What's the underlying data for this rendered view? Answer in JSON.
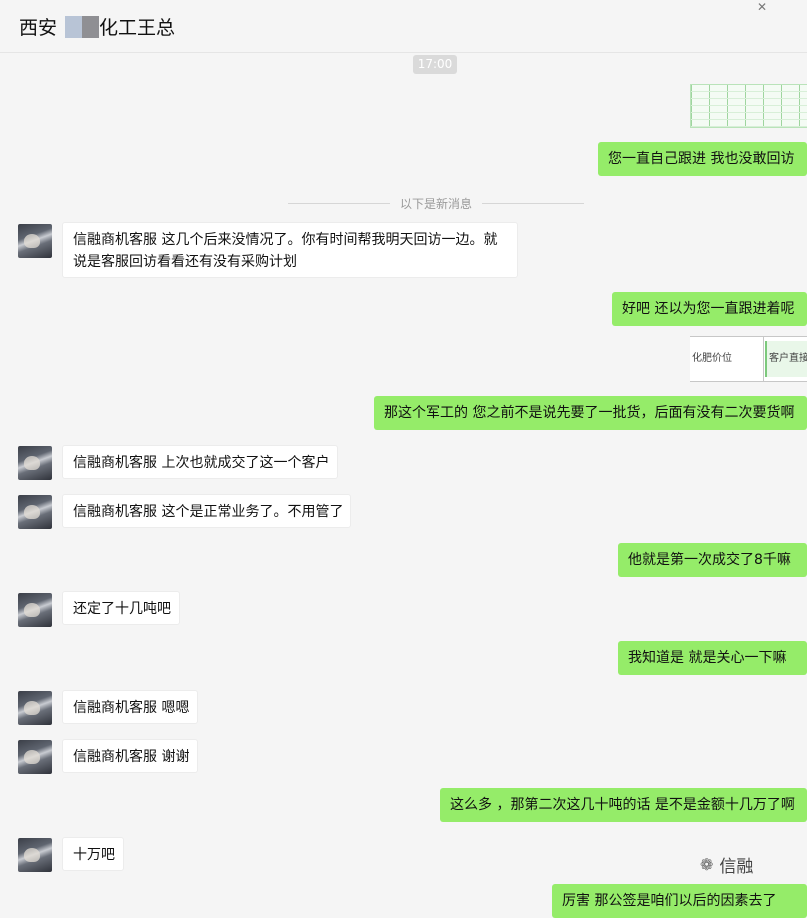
{
  "header": {
    "title_prefix": "西安",
    "title_suffix": "化工王总",
    "pin_icon": "pin-icon"
  },
  "timestamp": "17:00",
  "divider_text": "以下是新消息",
  "sheet_image": {
    "col1": "化肥价位",
    "col2": "客户直接联系"
  },
  "messages": [
    {
      "side": "right",
      "text": "您一直自己跟进  我也没敢回访"
    },
    {
      "side": "left",
      "text": "信融商机客服 这几个后来没情况了。你有时间帮我明天回访一边。就说是客服回访看看还有没有采购计划"
    },
    {
      "side": "right",
      "text": "好吧  还以为您一直跟进着呢"
    },
    {
      "side": "right",
      "text": "那这个军工的  您之前不是说先要了一批货，后面有没有二次要货啊"
    },
    {
      "side": "left",
      "text": "信融商机客服 上次也就成交了这一个客户"
    },
    {
      "side": "left",
      "text": "信融商机客服 这个是正常业务了。不用管了"
    },
    {
      "side": "right",
      "text": "他就是第一次成交了8千嘛"
    },
    {
      "side": "left",
      "text": "还定了十几吨吧"
    },
    {
      "side": "right",
      "text": "我知道是  就是关心一下嘛"
    },
    {
      "side": "left",
      "text": "信融商机客服 嗯嗯"
    },
    {
      "side": "left",
      "text": "信融商机客服 谢谢"
    },
    {
      "side": "right",
      "text": "这么多 ，那第二次这几十吨的话  是不是金额十几万了啊"
    },
    {
      "side": "left",
      "text": "十万吧"
    },
    {
      "side": "right",
      "text": "厉害  那公签是咱们以后的因素去了"
    }
  ],
  "watermark": {
    "icon": "wechat-icon",
    "text": "信融"
  }
}
